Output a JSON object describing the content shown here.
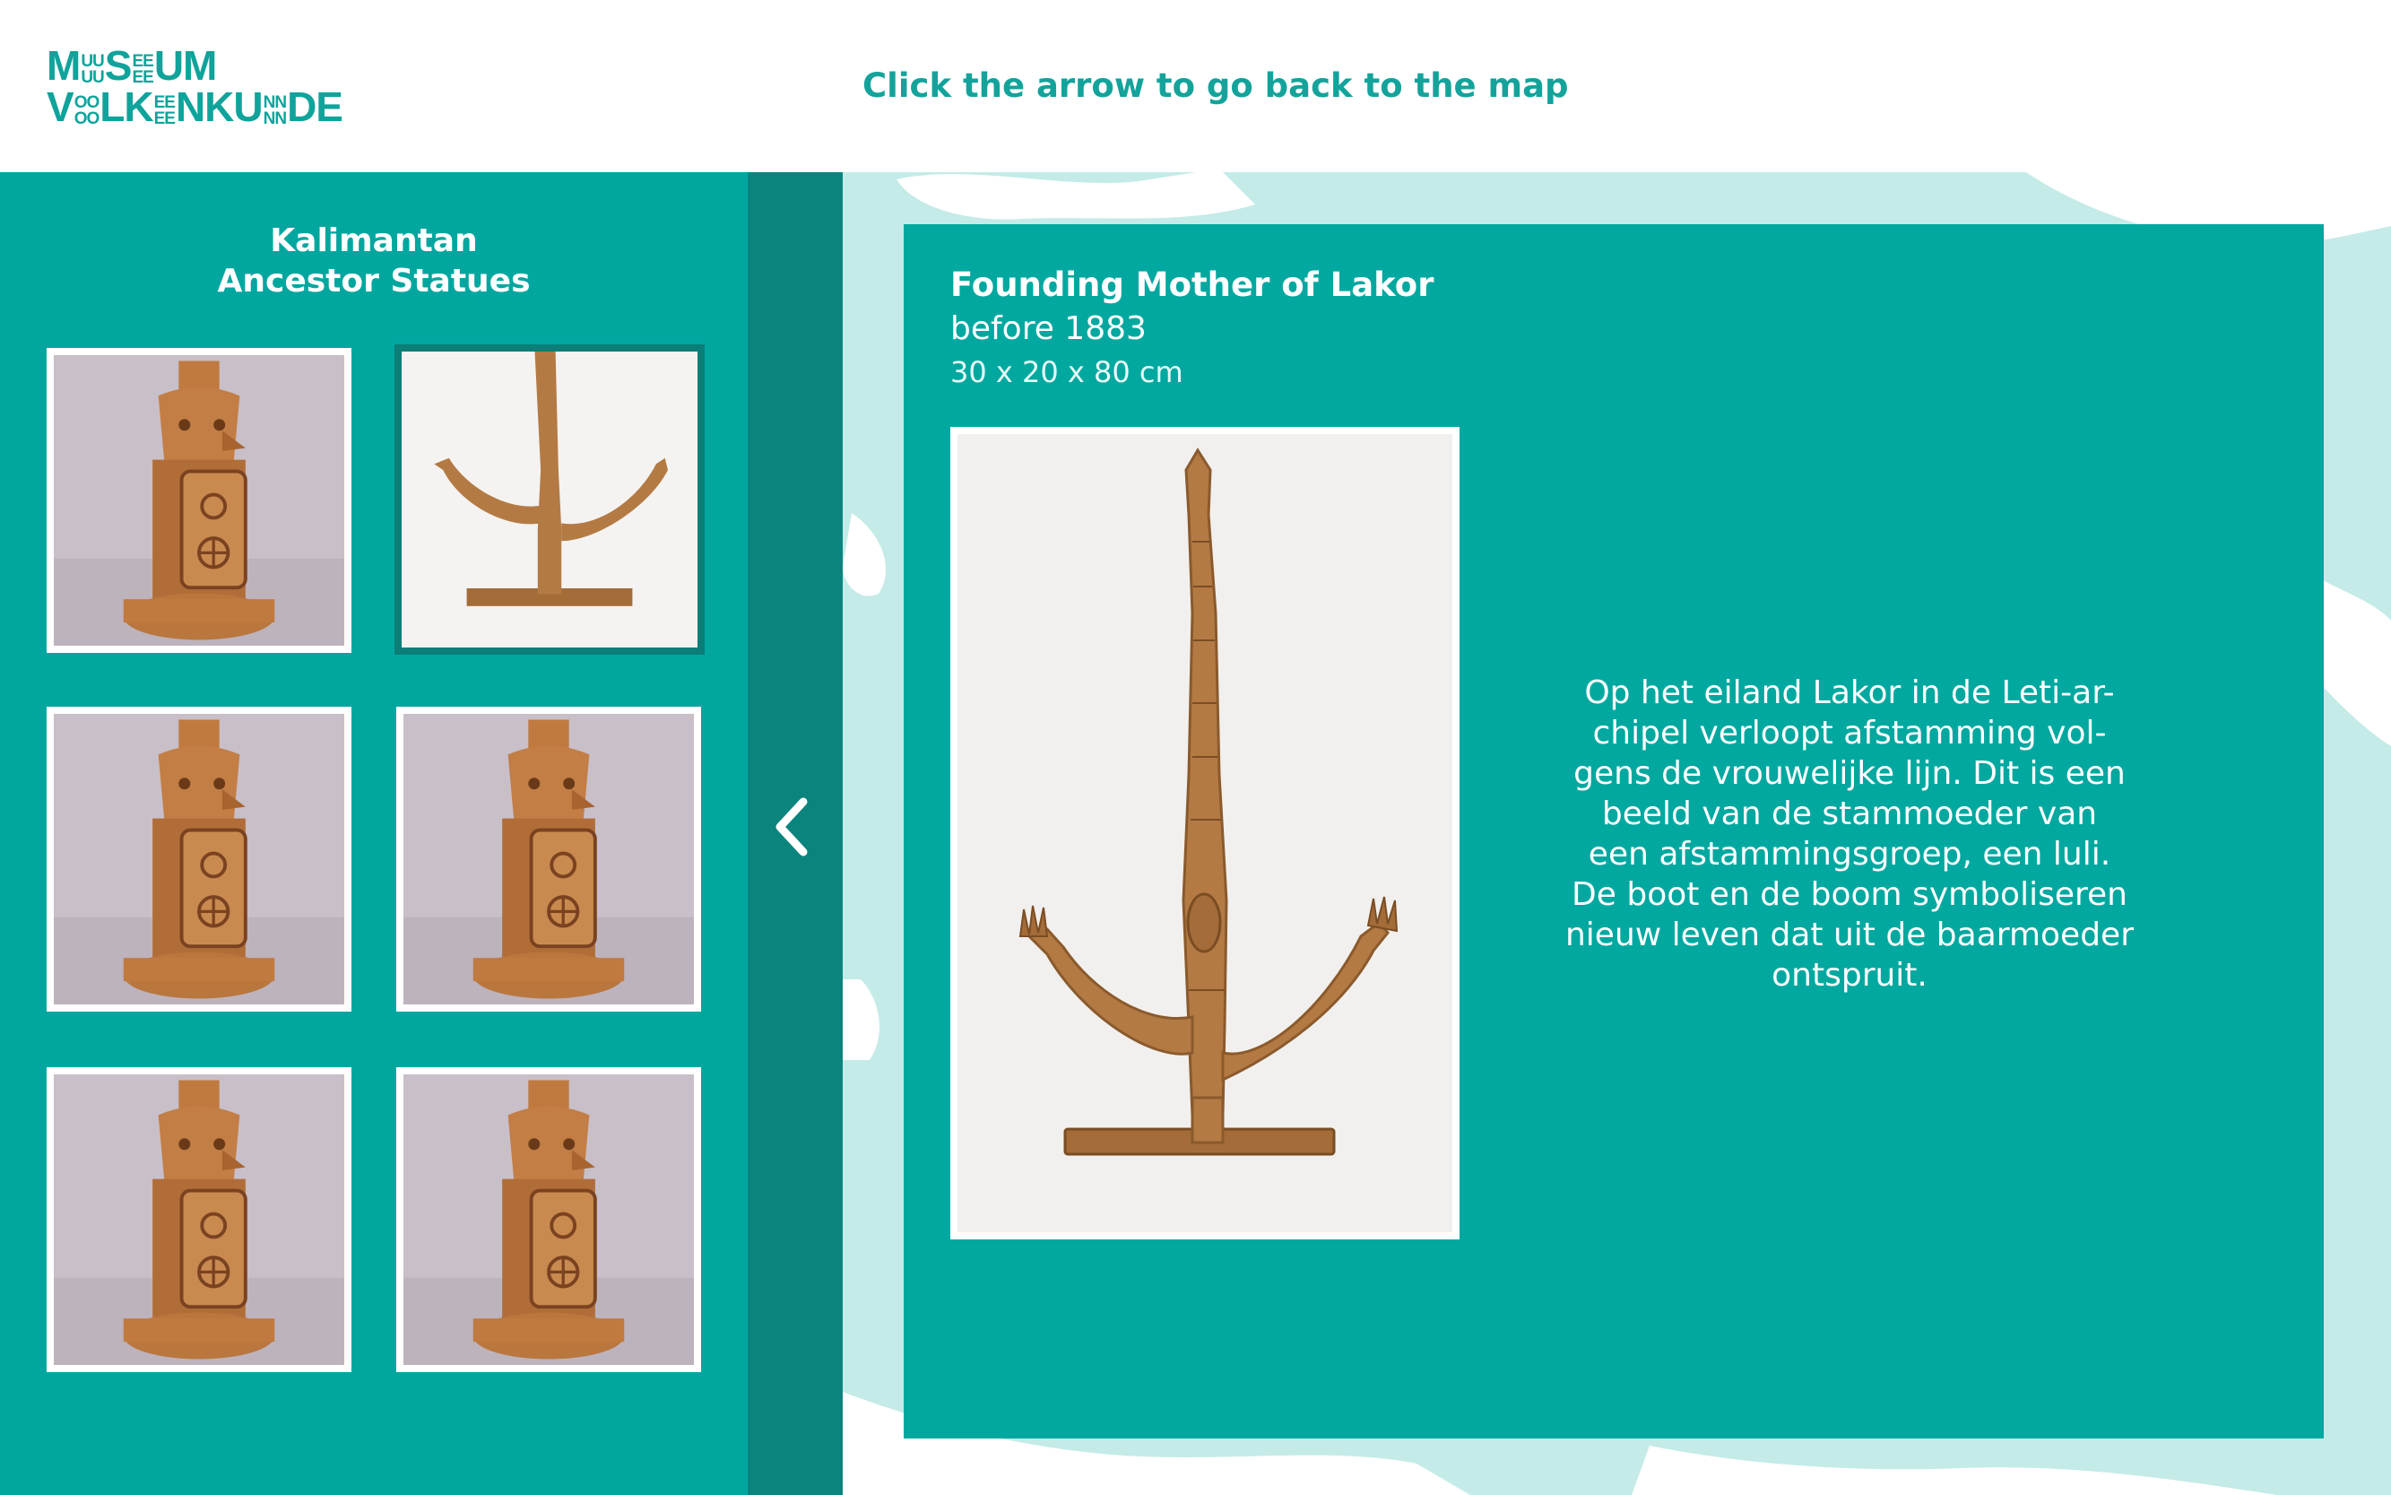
{
  "header": {
    "logo": {
      "alt": "Museum Volkenkunde",
      "line1": [
        "M",
        "UU|UU",
        "S",
        "EE|EE",
        "UM"
      ],
      "line2": [
        "V",
        "OO|OO",
        "LK",
        "EE|EE",
        "NKU",
        "NN|NN",
        "DE"
      ]
    },
    "instruction": "Click the arrow to go back to the map"
  },
  "collection": {
    "title_line1": "Kalimantan",
    "title_line2": "Ancestor Statues",
    "thumbnails": [
      {
        "kind": "statue",
        "selected": false
      },
      {
        "kind": "anchor",
        "selected": true
      },
      {
        "kind": "statue",
        "selected": false
      },
      {
        "kind": "statue",
        "selected": false
      },
      {
        "kind": "statue",
        "selected": false
      },
      {
        "kind": "statue",
        "selected": false
      }
    ]
  },
  "navigation": {
    "back_icon": "chevron-left-icon"
  },
  "detail": {
    "title": "Founding Mother of Lakor",
    "date": "before 1883",
    "dimensions": "30 x 20 x 80 cm",
    "description_lines": [
      "Op het eiland Lakor in de Leti-ar-",
      "chipel verloopt afstamming vol-",
      "gens de vrouwelijke lijn. Dit is een",
      "beeld van de stammoeder van",
      "een afstammingsgroep, een luli.",
      "De boot en de boom symboliseren",
      "nieuw leven dat uit de baarmoeder",
      "ontspruit."
    ]
  },
  "colors": {
    "teal": "#00a89f",
    "dark_teal": "#0a857d",
    "light_teal": "#c4ebe7",
    "wood": "#b67d45"
  }
}
